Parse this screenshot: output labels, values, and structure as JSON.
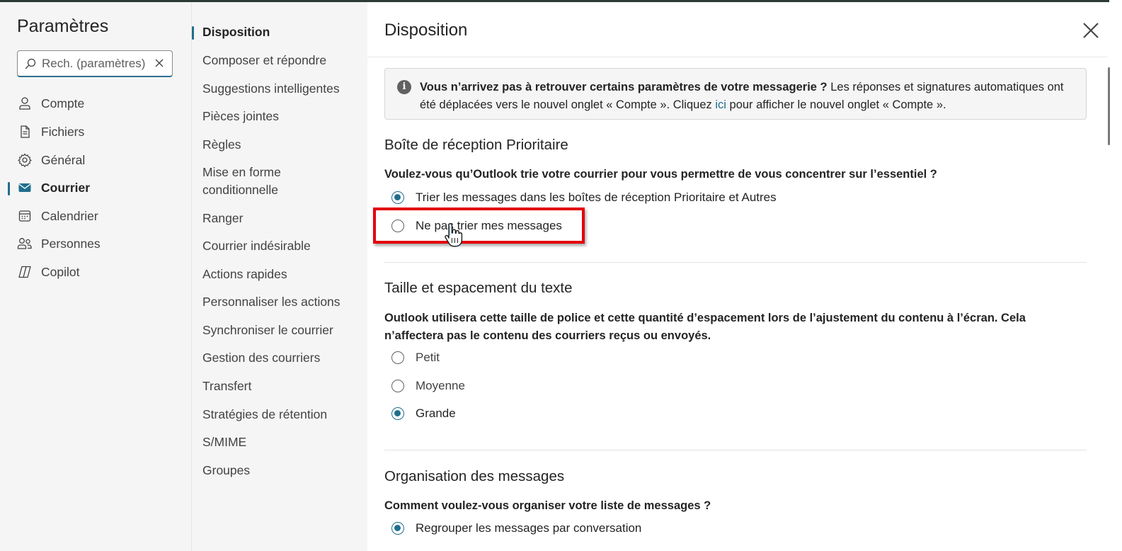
{
  "app": {
    "title": "Paramètres",
    "search": {
      "placeholder": "Rech. (paramètres)",
      "value": ""
    }
  },
  "nav": {
    "items": [
      {
        "label": "Compte",
        "icon": "person-icon",
        "active": false
      },
      {
        "label": "Fichiers",
        "icon": "document-icon",
        "active": false
      },
      {
        "label": "Général",
        "icon": "gear-icon",
        "active": false
      },
      {
        "label": "Courrier",
        "icon": "mail-icon",
        "active": true
      },
      {
        "label": "Calendrier",
        "icon": "calendar-icon",
        "active": false
      },
      {
        "label": "Personnes",
        "icon": "people-icon",
        "active": false
      },
      {
        "label": "Copilot",
        "icon": "copilot-icon",
        "active": false
      }
    ]
  },
  "subnav": {
    "items": [
      {
        "label": "Disposition",
        "active": true
      },
      {
        "label": "Composer et répondre"
      },
      {
        "label": "Suggestions intelligentes"
      },
      {
        "label": "Pièces jointes"
      },
      {
        "label": "Règles"
      },
      {
        "label": "Mise en forme conditionnelle"
      },
      {
        "label": "Ranger"
      },
      {
        "label": "Courrier indésirable"
      },
      {
        "label": "Actions rapides"
      },
      {
        "label": "Personnaliser les actions"
      },
      {
        "label": "Synchroniser le courrier"
      },
      {
        "label": "Gestion des courriers"
      },
      {
        "label": "Transfert"
      },
      {
        "label": "Stratégies de rétention"
      },
      {
        "label": "S/MIME"
      },
      {
        "label": "Groupes"
      }
    ]
  },
  "content": {
    "title": "Disposition",
    "info": {
      "bold": "Vous n’arrivez pas à retrouver certains paramètres de votre messagerie ?",
      "text1": " Les réponses et signatures automatiques ont été déplacées vers le nouvel onglet « Compte ». Cliquez ",
      "link": "ici",
      "text2": " pour afficher le nouvel onglet « Compte »."
    },
    "focused": {
      "title": "Boîte de réception Prioritaire",
      "question": "Voulez-vous qu’Outlook trie votre courrier pour vous permettre de vous concentrer sur l’essentiel ?",
      "options": [
        {
          "label": "Trier les messages dans les boîtes de réception Prioritaire et Autres",
          "checked": true
        },
        {
          "label": "Ne pas trier mes messages",
          "checked": false
        }
      ]
    },
    "textsize": {
      "title": "Taille et espacement du texte",
      "question": "Outlook utilisera cette taille de police et cette quantité d’espacement lors de l’ajustement du contenu à l’écran. Cela n’affectera pas le contenu des courriers reçus ou envoyés.",
      "options": [
        {
          "label": "Petit",
          "checked": false
        },
        {
          "label": "Moyenne",
          "checked": false
        },
        {
          "label": "Grande",
          "checked": true
        }
      ]
    },
    "organization": {
      "title": "Organisation des messages",
      "question": "Comment voulez-vous organiser votre liste de messages ?",
      "options": [
        {
          "label": "Regrouper les messages par conversation",
          "checked": true
        }
      ]
    }
  },
  "colors": {
    "accent": "#1f6e8c",
    "highlight": "#e3000b",
    "panel": "#f5f5f5"
  }
}
